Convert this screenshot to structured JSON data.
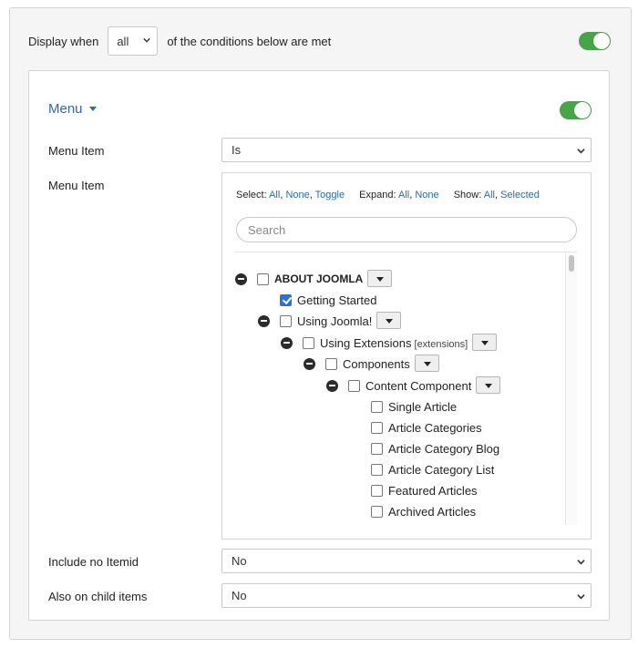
{
  "display_when": {
    "prefix": "Display when",
    "value": "all",
    "suffix": "of the conditions below are met",
    "toggle_on": true
  },
  "menu_condition": {
    "title": "Menu",
    "toggle_on": true,
    "fields": {
      "menu_item_operator": {
        "label": "Menu Item",
        "value": "Is"
      },
      "menu_item_tree_label": "Menu Item",
      "include_no_itemid": {
        "label": "Include no Itemid",
        "value": "No"
      },
      "also_on_child_items": {
        "label": "Also on child items",
        "value": "No"
      }
    },
    "tree": {
      "select_label": "Select:",
      "select_all": "All",
      "select_none": "None",
      "select_toggle": "Toggle",
      "expand_label": "Expand:",
      "expand_all": "All",
      "expand_none": "None",
      "show_label": "Show:",
      "show_all": "All",
      "show_selected": "Selected",
      "search_placeholder": "Search",
      "items": [
        {
          "label": "ABOUT JOOMLA",
          "extra": "",
          "checked": false,
          "collapsible": true,
          "has_dropdown": true,
          "bold": true
        },
        {
          "label": "Getting Started",
          "extra": "",
          "checked": true,
          "collapsible": false,
          "has_dropdown": false,
          "bold": false
        },
        {
          "label": "Using Joomla!",
          "extra": "",
          "checked": false,
          "collapsible": true,
          "has_dropdown": true,
          "bold": false
        },
        {
          "label": "Using Extensions",
          "extra": "[extensions]",
          "checked": false,
          "collapsible": true,
          "has_dropdown": true,
          "bold": false
        },
        {
          "label": "Components",
          "extra": "",
          "checked": false,
          "collapsible": true,
          "has_dropdown": true,
          "bold": false
        },
        {
          "label": "Content Component",
          "extra": "",
          "checked": false,
          "collapsible": true,
          "has_dropdown": true,
          "bold": false
        },
        {
          "label": "Single Article",
          "extra": "",
          "checked": false,
          "collapsible": false,
          "has_dropdown": false,
          "bold": false
        },
        {
          "label": "Article Categories",
          "extra": "",
          "checked": false,
          "collapsible": false,
          "has_dropdown": false,
          "bold": false
        },
        {
          "label": "Article Category Blog",
          "extra": "",
          "checked": false,
          "collapsible": false,
          "has_dropdown": false,
          "bold": false
        },
        {
          "label": "Article Category List",
          "extra": "",
          "checked": false,
          "collapsible": false,
          "has_dropdown": false,
          "bold": false
        },
        {
          "label": "Featured Articles",
          "extra": "",
          "checked": false,
          "collapsible": false,
          "has_dropdown": false,
          "bold": false
        },
        {
          "label": "Archived Articles",
          "extra": "",
          "checked": false,
          "collapsible": false,
          "has_dropdown": false,
          "bold": false
        }
      ]
    }
  },
  "colors": {
    "toggle_on": "#46a546",
    "link": "#2a69b8",
    "checkbox_checked": "#2a72d4"
  }
}
